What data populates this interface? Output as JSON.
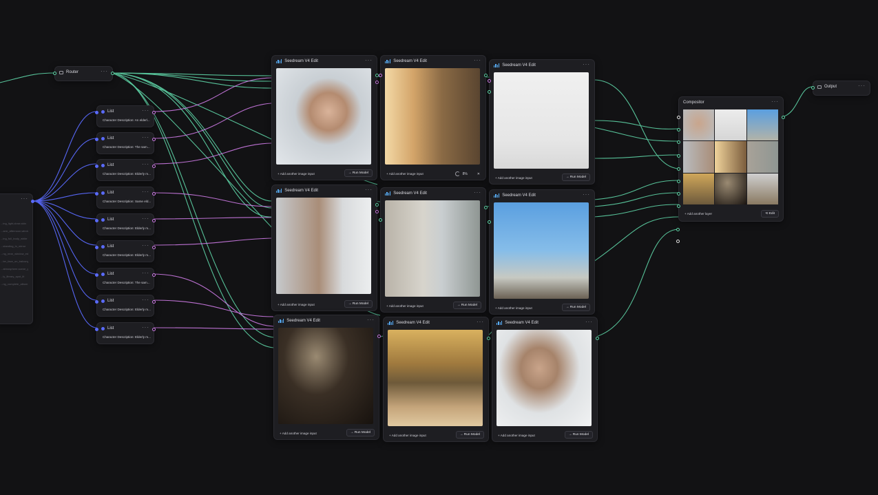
{
  "router": {
    "title": "Router"
  },
  "output": {
    "title": "Output"
  },
  "compositor": {
    "title": "Compositor",
    "add_label": "+ Add another layer",
    "edit_label": "Edit"
  },
  "lists": [
    {
      "title": "List",
      "desc": "Character Description: An elderl..."
    },
    {
      "title": "List",
      "desc": "Character Description: The sam..."
    },
    {
      "title": "List",
      "desc": "Character Description: Elderly m..."
    },
    {
      "title": "List",
      "desc": "Character Description: Same eld..."
    },
    {
      "title": "List",
      "desc": "Character Description: Elderly m..."
    },
    {
      "title": "List",
      "desc": "Character Description: Elderly m..."
    },
    {
      "title": "List",
      "desc": "Character Description: The sam..."
    },
    {
      "title": "List",
      "desc": "Character Description: Elderly m..."
    },
    {
      "title": "List",
      "desc": "Character Description: Elderly m..."
    }
  ],
  "input_lines": [
    "...ing_light,close,skin",
    "...arm_afternoon,window",
    "...ing_full_body_white",
    "...standing_in_mirror",
    "...ng_near_window_edit",
    "...ter_face_on_balcony",
    "...atmosphere,scene_gr",
    "...ly_library_spot_lit",
    "...ng_complete_album"
  ],
  "seedream": {
    "title": "Seedream V4 Edit",
    "add_input": "+ Add another image input",
    "run": "Run Model",
    "progress": "8%"
  },
  "colors": {
    "green": "#5fd6a8",
    "purple": "#d07ce8",
    "blue": "#5a6bff"
  }
}
